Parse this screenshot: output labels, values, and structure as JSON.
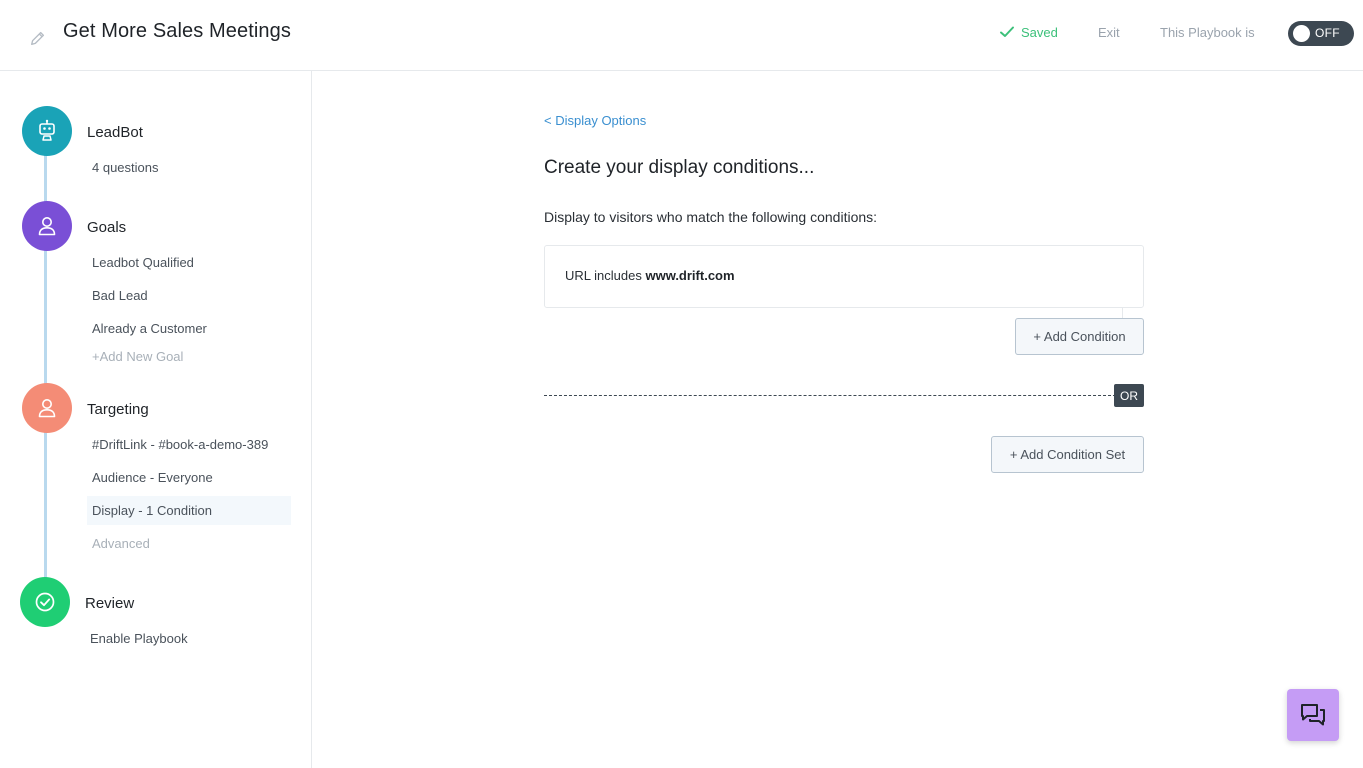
{
  "header": {
    "title": "Get More Sales Meetings",
    "saved_label": "Saved",
    "exit_label": "Exit",
    "playbook_status_label": "This Playbook is",
    "toggle_label": "OFF"
  },
  "sidebar": {
    "steps": [
      {
        "title": "LeadBot",
        "color": "#1aa3b7",
        "icon": "robot-icon",
        "items": [
          "4 questions"
        ]
      },
      {
        "title": "Goals",
        "color": "#7a4fd6",
        "icon": "user-icon",
        "items": [
          "Leadbot Qualified",
          "Bad Lead",
          "Already a Customer",
          "+Add New Goal"
        ]
      },
      {
        "title": "Targeting",
        "color": "#f48c76",
        "icon": "user-icon",
        "items": [
          "#DriftLink - #book-a-demo-389",
          "Audience - Everyone",
          "Display - 1 Condition",
          "Advanced"
        ]
      },
      {
        "title": "Review",
        "color": "#1fce74",
        "icon": "check-circle-icon",
        "items": [
          "Enable Playbook"
        ]
      }
    ]
  },
  "main": {
    "back_link": "< Display Options",
    "heading": "Create your display conditions...",
    "subtext": "Display to visitors who match the following conditions:",
    "condition": {
      "prefix": "URL includes",
      "value": "www.drift.com"
    },
    "add_condition_label": "+ Add Condition",
    "or_label": "OR",
    "add_condition_set_label": "+ Add Condition Set"
  },
  "colors": {
    "accent_link": "#3a8fd0",
    "saved_green": "#3cc07a",
    "toggle_bg": "#3d4852",
    "chat_bg": "#c59cf5"
  },
  "chat": {
    "icon": "chat-bubbles-icon"
  }
}
